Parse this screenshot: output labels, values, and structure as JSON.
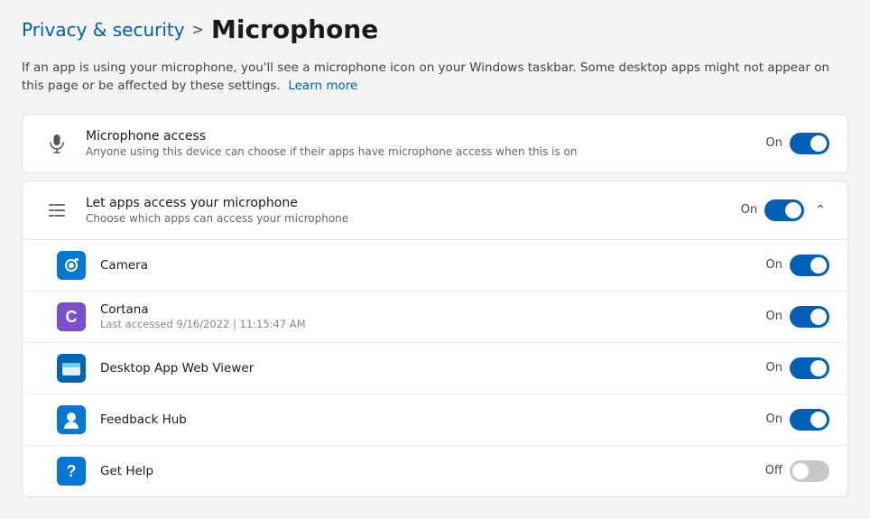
{
  "breadcrumb": {
    "parent": "Privacy & security",
    "separator": ">",
    "current": "Microphone"
  },
  "description": {
    "text": "If an app is using your microphone, you'll see a microphone icon on your Windows taskbar. Some desktop apps might not appear on this page or be affected by these settings.",
    "learn_more_label": "Learn more"
  },
  "microphone_access": {
    "title": "Microphone access",
    "subtitle": "Anyone using this device can choose if their apps have microphone access when this is on",
    "status": "On",
    "enabled": true
  },
  "let_apps": {
    "title": "Let apps access your microphone",
    "subtitle": "Choose which apps can access your microphone",
    "status": "On",
    "enabled": true
  },
  "apps": [
    {
      "name": "Camera",
      "last_accessed": "",
      "status": "On",
      "enabled": true,
      "icon_color": "#0078d4",
      "icon_symbol": "📷"
    },
    {
      "name": "Cortana",
      "last_accessed": "Last accessed 9/16/2022  |  11:15:47 AM",
      "status": "On",
      "enabled": true,
      "icon_color": "#7b4fcc",
      "icon_symbol": "C"
    },
    {
      "name": "Desktop App Web Viewer",
      "last_accessed": "",
      "status": "On",
      "enabled": true,
      "icon_color": "#0066b4",
      "icon_symbol": "⬛"
    },
    {
      "name": "Feedback Hub",
      "last_accessed": "",
      "status": "On",
      "enabled": true,
      "icon_color": "#0078d4",
      "icon_symbol": "👤"
    },
    {
      "name": "Get Help",
      "last_accessed": "",
      "status": "Off",
      "enabled": false,
      "icon_color": "#0078d4",
      "icon_symbol": "?"
    }
  ]
}
